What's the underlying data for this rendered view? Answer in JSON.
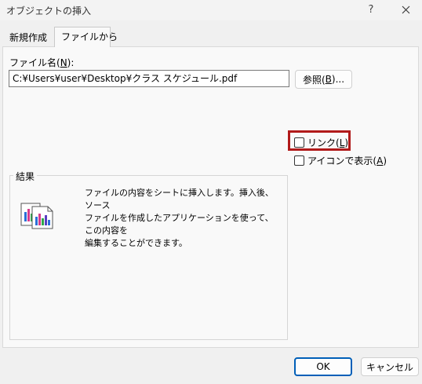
{
  "window": {
    "title": "オブジェクトの挿入",
    "help_label": "?",
    "close_icon": "close-icon"
  },
  "tabs": [
    {
      "label": "新規作成",
      "active": false
    },
    {
      "label": "ファイルから",
      "active": true
    }
  ],
  "file": {
    "label_prefix": "ファイル名(",
    "label_key": "N",
    "label_suffix": "):",
    "value": "C:¥Users¥user¥Desktop¥クラス スケジュール.pdf",
    "browse_prefix": "参照(",
    "browse_key": "B",
    "browse_suffix": ")..."
  },
  "options": {
    "link_prefix": "リンク(",
    "link_key": "L",
    "link_suffix": ")",
    "link_checked": false,
    "link_highlighted": true,
    "highlight_color": "#b11a1a",
    "icon_prefix": "アイコンで表示(",
    "icon_key": "A",
    "icon_suffix": ")",
    "icon_checked": false
  },
  "result": {
    "legend": "結果",
    "line1": "ファイルの内容をシートに挿入します。挿入後、ソース",
    "line2": "ファイルを作成したアプリケーションを使って、この内容を",
    "line3": "編集することができます。",
    "icon": "embedded-document-icon"
  },
  "buttons": {
    "ok": "OK",
    "cancel": "キャンセル",
    "accent": "#005fb8"
  }
}
